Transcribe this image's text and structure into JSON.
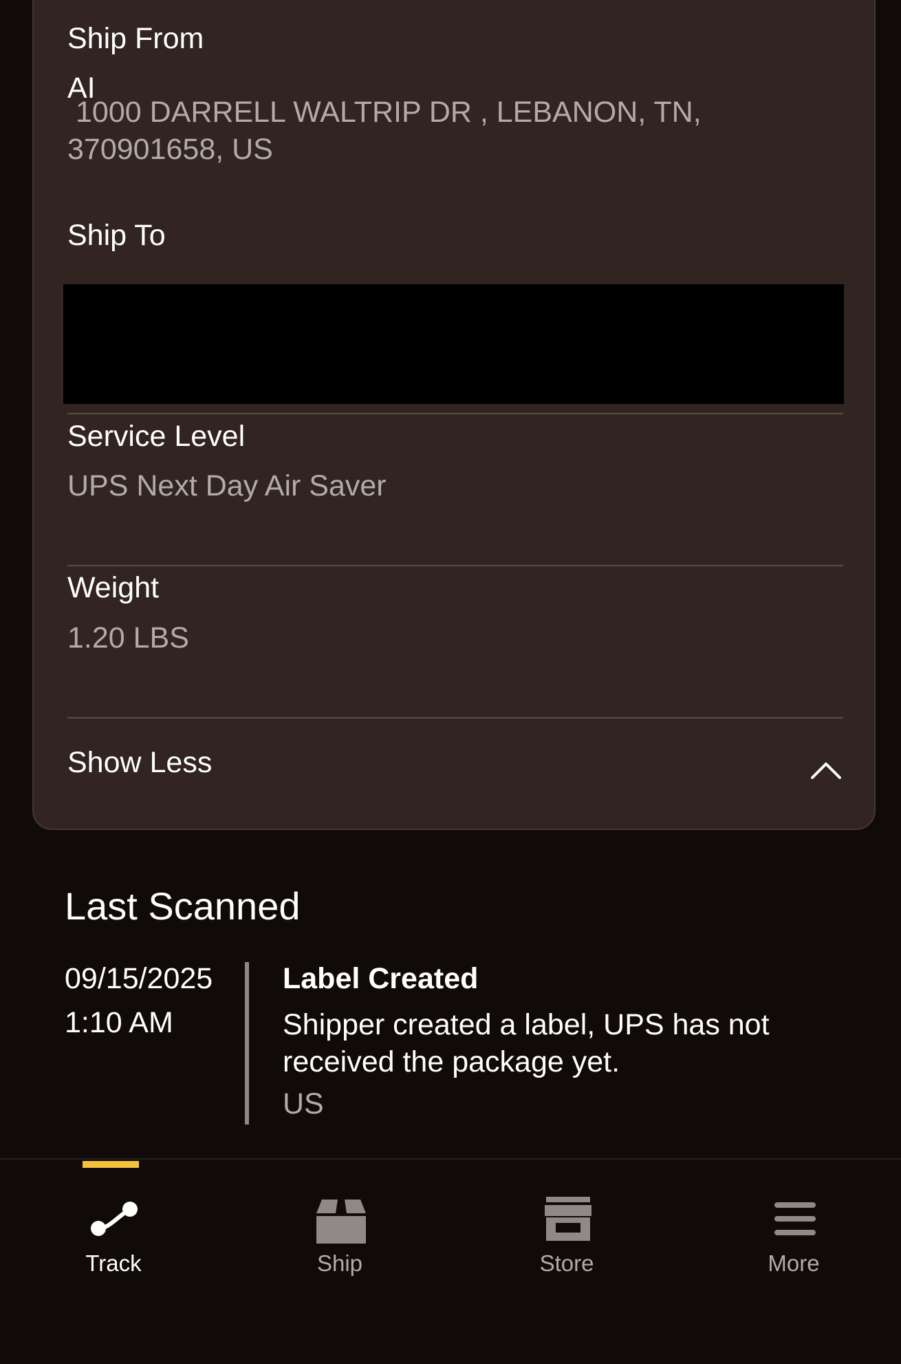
{
  "details": {
    "ship_from_label": "Ship From",
    "ship_from_name": "AI",
    "ship_from_address": "1000 DARRELL WALTRIP DR , LEBANON, TN, 370901658, US",
    "ship_to_label": "Ship To",
    "service_level_label": "Service Level",
    "service_level_value": "UPS Next Day Air Saver",
    "weight_label": "Weight",
    "weight_value": "1.20 LBS",
    "toggle_label": "Show Less"
  },
  "last_scanned": {
    "title": "Last Scanned",
    "date": "09/15/2025",
    "time": "1:10 AM",
    "status": "Label Created",
    "description": "Shipper created a label, UPS has not received the package yet.",
    "location": "US"
  },
  "nav": {
    "items": [
      {
        "label": "Track",
        "icon": "track-icon",
        "active": true
      },
      {
        "label": "Ship",
        "icon": "package-icon",
        "active": false
      },
      {
        "label": "Store",
        "icon": "store-icon",
        "active": false
      },
      {
        "label": "More",
        "icon": "menu-icon",
        "active": false
      }
    ]
  },
  "colors": {
    "background": "#100a09",
    "card": "#312421",
    "muted_text": "#b3aba8",
    "accent": "#f5c23e"
  }
}
